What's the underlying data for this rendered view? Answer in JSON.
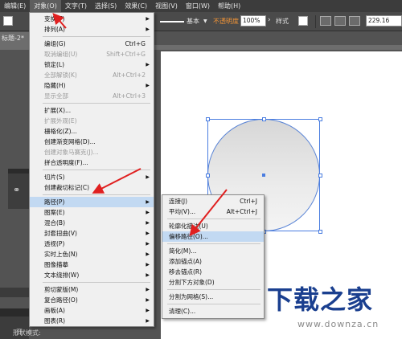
{
  "menubar": [
    "编辑(E)",
    "对象(O)",
    "文字(T)",
    "选择(S)",
    "效果(C)",
    "视图(V)",
    "窗口(W)",
    "帮助(H)"
  ],
  "control_bar": {
    "stroke_style": "基本",
    "opacity_label": "不透明度",
    "opacity_value": "100%",
    "style_label": "样式",
    "coord_value": "229.16"
  },
  "doc_tab": "标题-2*",
  "object_menu": [
    {
      "label": "变换(T)",
      "arrow": true
    },
    {
      "label": "排列(A)",
      "arrow": true
    },
    {
      "sep": true
    },
    {
      "label": "编组(G)",
      "shortcut": "Ctrl+G"
    },
    {
      "label": "取消编组(U)",
      "shortcut": "Shift+Ctrl+G",
      "disabled": true
    },
    {
      "label": "锁定(L)",
      "arrow": true
    },
    {
      "label": "全部解锁(K)",
      "shortcut": "Alt+Ctrl+2",
      "disabled": true
    },
    {
      "label": "隐藏(H)",
      "arrow": true
    },
    {
      "label": "显示全部",
      "shortcut": "Alt+Ctrl+3",
      "disabled": true
    },
    {
      "sep": true
    },
    {
      "label": "扩展(X)..."
    },
    {
      "label": "扩展外观(E)",
      "disabled": true
    },
    {
      "label": "栅格化(Z)..."
    },
    {
      "label": "创建渐变网格(D)..."
    },
    {
      "label": "创建对象马赛克(J)...",
      "disabled": true
    },
    {
      "label": "拼合透明度(F)..."
    },
    {
      "sep": true
    },
    {
      "label": "切片(S)",
      "arrow": true
    },
    {
      "label": "创建裁切标记(C)"
    },
    {
      "sep": true
    },
    {
      "label": "路径(P)",
      "arrow": true,
      "highlighted": true
    },
    {
      "label": "图案(E)",
      "arrow": true
    },
    {
      "label": "混合(B)",
      "arrow": true
    },
    {
      "label": "封套扭曲(V)",
      "arrow": true
    },
    {
      "label": "透视(P)",
      "arrow": true
    },
    {
      "label": "实时上色(N)",
      "arrow": true
    },
    {
      "label": "图像描摹",
      "arrow": true
    },
    {
      "label": "文本绕排(W)",
      "arrow": true
    },
    {
      "sep": true
    },
    {
      "label": "剪切蒙版(M)",
      "arrow": true
    },
    {
      "label": "复合路径(O)",
      "arrow": true
    },
    {
      "label": "画板(A)",
      "arrow": true
    },
    {
      "label": "图表(R)",
      "arrow": true
    }
  ],
  "path_submenu": [
    {
      "label": "连接(J)",
      "shortcut": "Ctrl+J"
    },
    {
      "label": "平均(V)...",
      "shortcut": "Alt+Ctrl+J"
    },
    {
      "sep": true
    },
    {
      "label": "轮廓化描边(U)"
    },
    {
      "label": "偏移路径(O)...",
      "highlighted": true
    },
    {
      "sep": true
    },
    {
      "label": "简化(M)..."
    },
    {
      "label": "添加锚点(A)"
    },
    {
      "label": "移去锚点(R)"
    },
    {
      "label": "分割下方对象(D)"
    },
    {
      "sep": true
    },
    {
      "label": "分割为网格(S)..."
    },
    {
      "sep": true
    },
    {
      "label": "清理(C)..."
    }
  ],
  "left_fragments": {
    "bottom_panel_text": "开",
    "shape_mode": "形状模式:"
  },
  "watermark": {
    "title": "下载之家",
    "url": "www.downza.cn"
  },
  "colors": {
    "annotation_arrow": "#e02020",
    "selection": "#4a7de0",
    "menu_highlight": "#c2d9f2"
  }
}
